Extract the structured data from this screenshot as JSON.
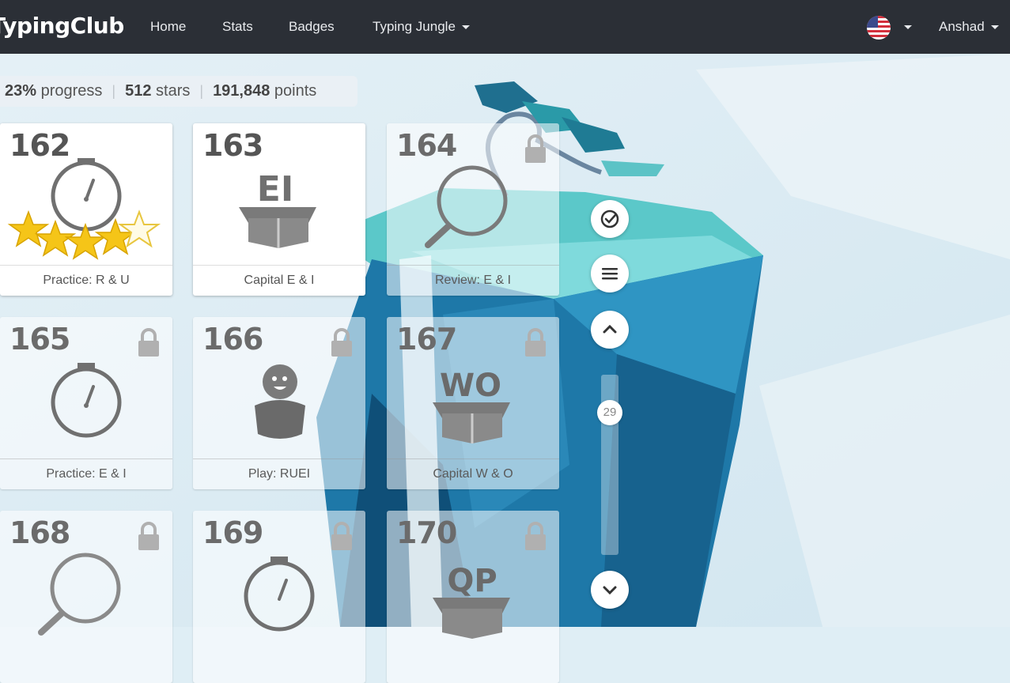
{
  "nav": {
    "brand": "TypingClub",
    "links": [
      "Home",
      "Stats",
      "Badges",
      "Typing Jungle"
    ],
    "user": "Anshad"
  },
  "progress": {
    "percent": "23%",
    "percent_label": "progress",
    "stars": "512",
    "stars_label": "stars",
    "points": "191,848",
    "points_label": "points"
  },
  "lessons": [
    {
      "number": "162",
      "title": "Practice: R & U",
      "icon": "stopwatch-icon",
      "stars_earned": 4,
      "stars_total": 5,
      "locked": false
    },
    {
      "number": "163",
      "title": "Capital E & I",
      "icon": "box-icon",
      "box_text": "EI",
      "locked": false
    },
    {
      "number": "164",
      "title": "Review: E & I",
      "icon": "magnifier-icon",
      "locked": true
    },
    {
      "number": "165",
      "title": "Practice: E & I",
      "icon": "stopwatch-icon",
      "locked": true
    },
    {
      "number": "166",
      "title": "Play: RUEI",
      "icon": "game-character-icon",
      "locked": true
    },
    {
      "number": "167",
      "title": "Capital W & O",
      "icon": "box-icon",
      "box_text": "WO",
      "locked": true
    },
    {
      "number": "168",
      "title": "",
      "icon": "magnifier-icon",
      "locked": true
    },
    {
      "number": "169",
      "title": "",
      "icon": "stopwatch-icon",
      "locked": true
    },
    {
      "number": "170",
      "title": "",
      "icon": "box-icon",
      "box_text": "QP",
      "locked": true
    }
  ],
  "controls": {
    "scroll_position": "29",
    "icons": [
      "check-circle-icon",
      "menu-icon",
      "chevron-up-icon",
      "chevron-down-icon"
    ]
  },
  "colors": {
    "navbar": "#2b2f36",
    "star": "#f5c518",
    "icon_gray": "#707070"
  }
}
